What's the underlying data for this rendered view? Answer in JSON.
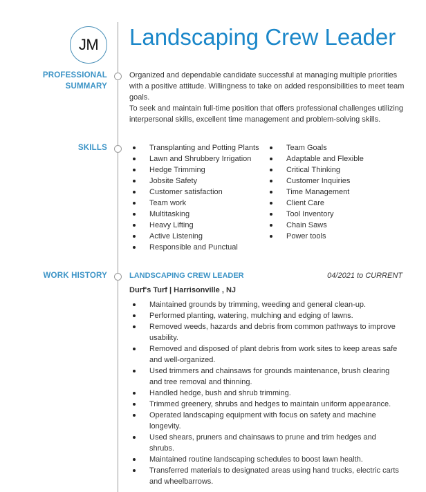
{
  "header": {
    "initials": "JM",
    "title": "Landscaping Crew Leader"
  },
  "sections": {
    "summary": {
      "label_line1": "PROFESSIONAL",
      "label_line2": "SUMMARY",
      "paragraph1": "Organized and dependable candidate successful at managing multiple priorities with a positive attitude. Willingness to take on added responsibilities to meet team goals.",
      "paragraph2": "To seek and maintain full-time position that offers professional challenges utilizing interpersonal skills, excellent time management and problem-solving skills."
    },
    "skills": {
      "label": "SKILLS",
      "column1": [
        "Transplanting and Potting Plants",
        "Lawn and Shrubbery Irrigation",
        "Hedge Trimming",
        "Jobsite Safety",
        "Customer satisfaction",
        "Team work",
        "Multitasking",
        "Heavy Lifting",
        "Active Listening",
        "Responsible and Punctual"
      ],
      "column2": [
        "Team Goals",
        "Adaptable and Flexible",
        "Critical Thinking",
        "Customer Inquiries",
        "Time Management",
        "Client Care",
        "Tool Inventory",
        "Chain Saws",
        "Power tools"
      ]
    },
    "work_history": {
      "label": "WORK HISTORY",
      "jobs": [
        {
          "title": "LANDSCAPING CREW LEADER",
          "dates": "04/2021 to CURRENT",
          "company": "Durf's Turf | Harrisonville , NJ",
          "bullets": [
            "Maintained grounds by trimming, weeding and general clean-up.",
            "Performed planting, watering, mulching and edging of lawns.",
            "Removed weeds, hazards and debris from common pathways to improve usability.",
            "Removed and disposed of plant debris from work sites to keep areas safe and well-organized.",
            "Used trimmers and chainsaws for grounds maintenance, brush clearing and tree removal and thinning.",
            "Handled hedge, bush and shrub trimming.",
            "Trimmed greenery, shrubs and hedges to maintain uniform appearance.",
            "Operated landscaping equipment with focus on safety and machine longevity.",
            "Used shears, pruners and chainsaws to prune and trim hedges and shrubs.",
            "Maintained routine landscaping schedules to boost lawn health.",
            "Transferred materials to designated areas using hand trucks, electric carts and wheelbarrows."
          ]
        }
      ]
    }
  },
  "colors": {
    "accent": "#1b87c9",
    "section_label": "#3b93c6",
    "text": "#333333",
    "timeline": "#9a9a9a"
  }
}
